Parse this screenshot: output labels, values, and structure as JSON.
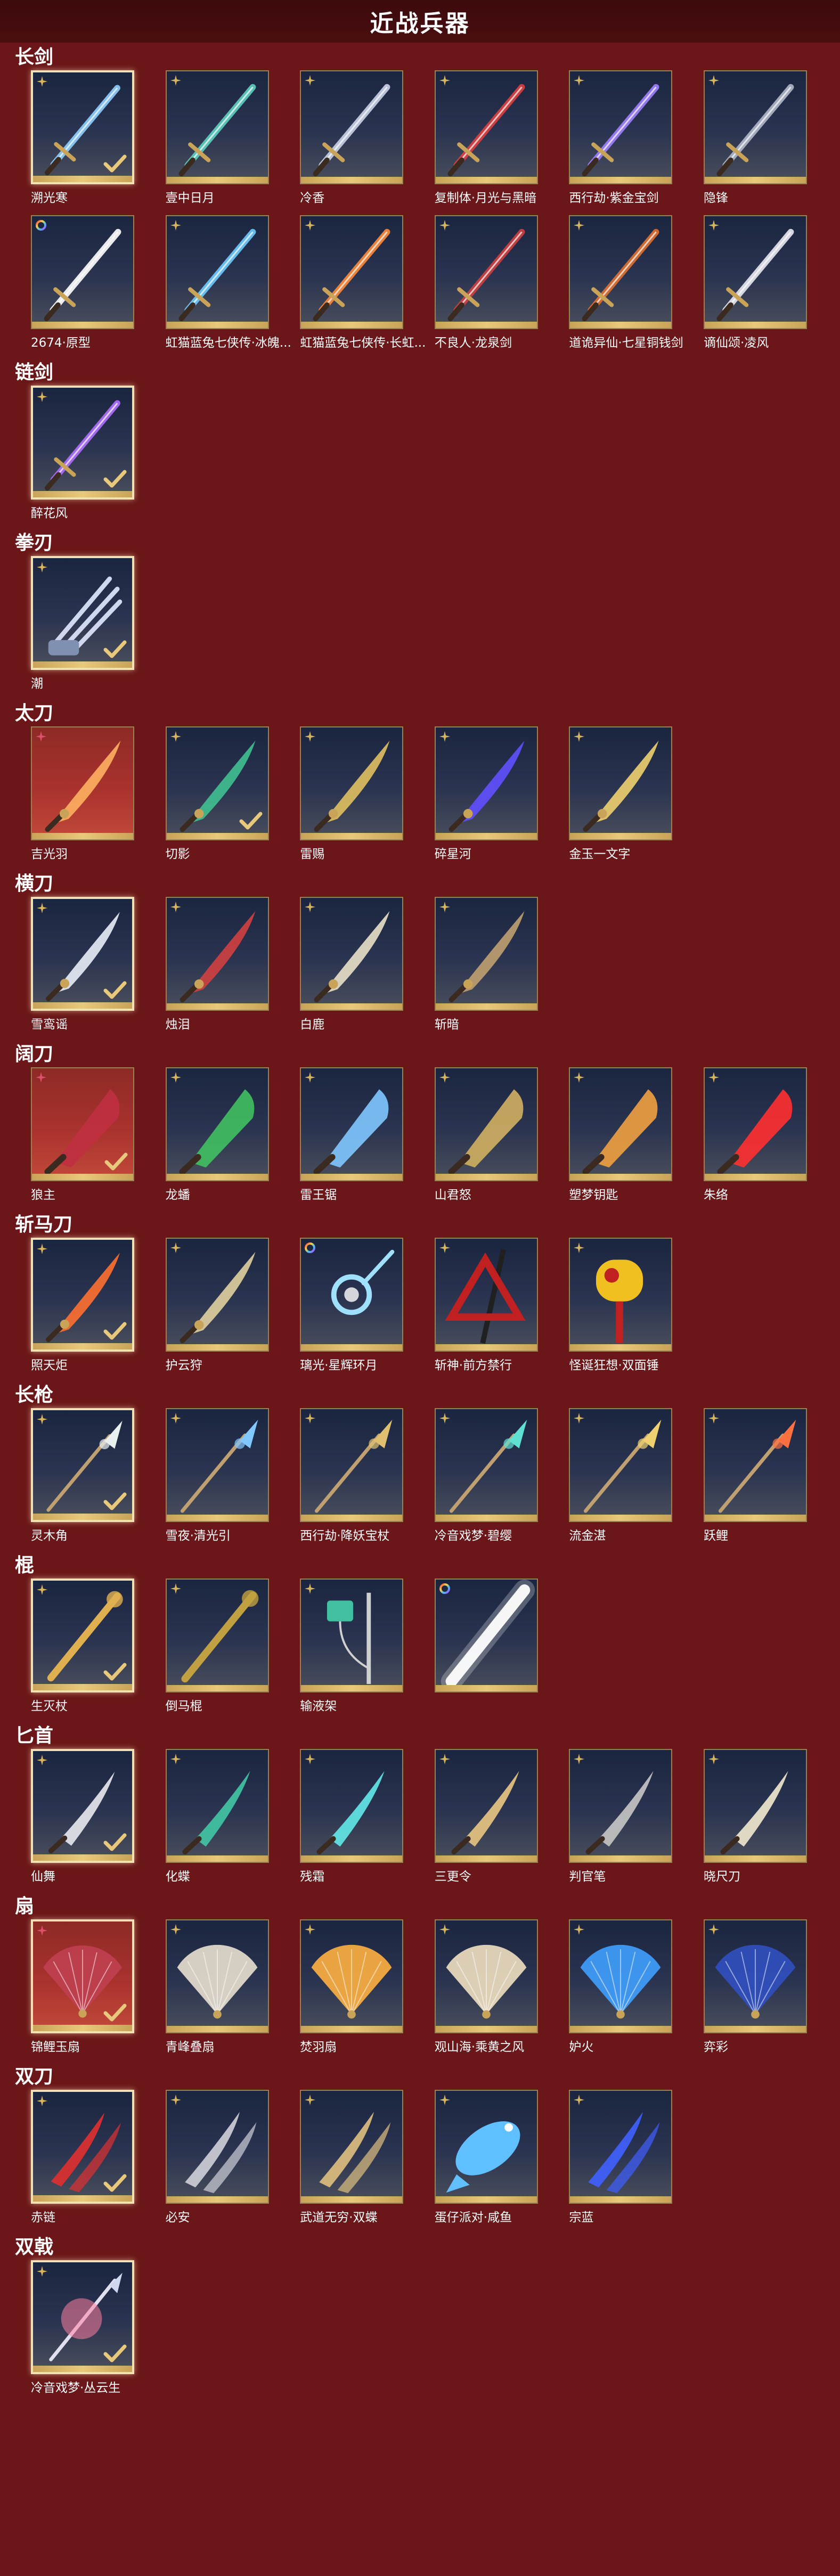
{
  "header": {
    "title": "近战兵器"
  },
  "colors": {
    "background": "#6b1618",
    "header": "#3c0a0c",
    "tile_frame": "#9a8050",
    "tile_frame_selected": "#f1e1b4",
    "tile_bar": "#e8c87a",
    "rarity_gold": "#d9b45a",
    "rarity_red": "#e0506a"
  },
  "sections": [
    {
      "title": "长剑",
      "items": [
        {
          "name": "溯光寒",
          "rarity": "gold",
          "selected": true,
          "checked": true,
          "art": "sword",
          "hue": "#8fd0ff"
        },
        {
          "name": "壹中日月",
          "rarity": "gold",
          "selected": false,
          "checked": false,
          "art": "sword",
          "hue": "#5fd0c0"
        },
        {
          "name": "冷香",
          "rarity": "gold",
          "selected": false,
          "checked": false,
          "art": "sword",
          "hue": "#c9d2e6"
        },
        {
          "name": "复制体·月光与黑暗",
          "rarity": "gold",
          "selected": false,
          "checked": false,
          "art": "sword",
          "hue": "#e04040"
        },
        {
          "name": "西行劫·紫金宝剑",
          "rarity": "gold",
          "selected": false,
          "checked": false,
          "art": "sword",
          "hue": "#a080ff"
        },
        {
          "name": "隐锋",
          "rarity": "gold",
          "selected": false,
          "checked": false,
          "art": "sword",
          "hue": "#b0b8c8"
        },
        {
          "name": "2674·原型",
          "rarity": "rainbow",
          "selected": false,
          "checked": false,
          "art": "sword",
          "hue": "#ffffff"
        },
        {
          "name": "虹猫蓝兔七侠传·冰魄...",
          "rarity": "gold",
          "selected": false,
          "checked": false,
          "art": "sword",
          "hue": "#6ecbff"
        },
        {
          "name": "虹猫蓝兔七侠传·长虹...",
          "rarity": "gold",
          "selected": false,
          "checked": false,
          "art": "sword",
          "hue": "#ff8a3a"
        },
        {
          "name": "不良人·龙泉剑",
          "rarity": "gold",
          "selected": false,
          "checked": false,
          "art": "sword",
          "hue": "#d04040"
        },
        {
          "name": "道诡异仙·七星铜钱剑",
          "rarity": "gold",
          "selected": false,
          "checked": false,
          "art": "sword",
          "hue": "#e07030"
        },
        {
          "name": "谪仙颂·凌风",
          "rarity": "gold",
          "selected": false,
          "checked": false,
          "art": "sword",
          "hue": "#e8e8f0"
        }
      ]
    },
    {
      "title": "链剑",
      "items": [
        {
          "name": "醉花风",
          "rarity": "gold",
          "selected": true,
          "checked": true,
          "art": "sword",
          "hue": "#b070ff"
        }
      ]
    },
    {
      "title": "拳刃",
      "items": [
        {
          "name": "潮",
          "rarity": "gold",
          "selected": true,
          "checked": true,
          "art": "claw",
          "hue": "#d0d8f0"
        }
      ]
    },
    {
      "title": "太刀",
      "items": [
        {
          "name": "吉光羽",
          "rarity": "red",
          "selected": false,
          "checked": false,
          "art": "blade",
          "hue": "#ffb060"
        },
        {
          "name": "切影",
          "rarity": "gold",
          "selected": false,
          "checked": true,
          "art": "blade",
          "hue": "#40c090"
        },
        {
          "name": "雷赐",
          "rarity": "gold",
          "selected": false,
          "checked": false,
          "art": "blade",
          "hue": "#e0c060"
        },
        {
          "name": "碎星河",
          "rarity": "gold",
          "selected": false,
          "checked": false,
          "art": "blade",
          "hue": "#6050ff"
        },
        {
          "name": "金玉一文字",
          "rarity": "gold",
          "selected": false,
          "checked": false,
          "art": "blade",
          "hue": "#f0d070"
        }
      ]
    },
    {
      "title": "横刀",
      "items": [
        {
          "name": "雪鸾谣",
          "rarity": "gold",
          "selected": true,
          "checked": true,
          "art": "blade",
          "hue": "#e8eef8"
        },
        {
          "name": "烛泪",
          "rarity": "gold",
          "selected": false,
          "checked": false,
          "art": "blade",
          "hue": "#d04040"
        },
        {
          "name": "白鹿",
          "rarity": "gold",
          "selected": false,
          "checked": false,
          "art": "blade",
          "hue": "#e8e0c8"
        },
        {
          "name": "斩暗",
          "rarity": "gold",
          "selected": false,
          "checked": false,
          "art": "blade",
          "hue": "#c0a070"
        }
      ]
    },
    {
      "title": "阔刀",
      "items": [
        {
          "name": "狼主",
          "rarity": "red",
          "selected": false,
          "checked": true,
          "art": "broad",
          "hue": "#c03040"
        },
        {
          "name": "龙蟠",
          "rarity": "gold",
          "selected": false,
          "checked": false,
          "art": "broad",
          "hue": "#40c060"
        },
        {
          "name": "雷王锯",
          "rarity": "gold",
          "selected": false,
          "checked": false,
          "art": "broad",
          "hue": "#80c8ff"
        },
        {
          "name": "山君怒",
          "rarity": "gold",
          "selected": false,
          "checked": false,
          "art": "broad",
          "hue": "#d0b060"
        },
        {
          "name": "塑梦钥匙",
          "rarity": "gold",
          "selected": false,
          "checked": false,
          "art": "broad",
          "hue": "#f0a040"
        },
        {
          "name": "朱络",
          "rarity": "gold",
          "selected": false,
          "checked": false,
          "art": "broad",
          "hue": "#ff3030"
        }
      ]
    },
    {
      "title": "斩马刀",
      "items": [
        {
          "name": "照天炬",
          "rarity": "gold",
          "selected": true,
          "checked": true,
          "art": "blade",
          "hue": "#ff7030"
        },
        {
          "name": "护云狩",
          "rarity": "gold",
          "selected": false,
          "checked": false,
          "art": "blade",
          "hue": "#e0d0a0"
        },
        {
          "name": "璃光·星辉环月",
          "rarity": "rainbow",
          "selected": false,
          "checked": false,
          "art": "ring",
          "hue": "#a0e0ff"
        },
        {
          "name": "斩神·前方禁行",
          "rarity": "gold",
          "selected": false,
          "checked": false,
          "art": "sign",
          "hue": "#c02020"
        },
        {
          "name": "怪诞狂想·双面锤",
          "rarity": "gold",
          "selected": false,
          "checked": false,
          "art": "hammer",
          "hue": "#f0c020"
        }
      ]
    },
    {
      "title": "长枪",
      "items": [
        {
          "name": "灵木角",
          "rarity": "gold",
          "selected": true,
          "checked": true,
          "art": "spear",
          "hue": "#e8f0f0"
        },
        {
          "name": "雪夜·清光引",
          "rarity": "gold",
          "selected": false,
          "checked": false,
          "art": "spear",
          "hue": "#80c8ff"
        },
        {
          "name": "西行劫·降妖宝杖",
          "rarity": "gold",
          "selected": false,
          "checked": false,
          "art": "spear",
          "hue": "#e0c070"
        },
        {
          "name": "冷音戏梦·碧缨",
          "rarity": "gold",
          "selected": false,
          "checked": false,
          "art": "spear",
          "hue": "#60e0d0"
        },
        {
          "name": "流金湛",
          "rarity": "gold",
          "selected": false,
          "checked": false,
          "art": "spear",
          "hue": "#f0d070"
        },
        {
          "name": "跃鲤",
          "rarity": "gold",
          "selected": false,
          "checked": false,
          "art": "spear",
          "hue": "#ff7040"
        }
      ]
    },
    {
      "title": "棍",
      "items": [
        {
          "name": "生灭杖",
          "rarity": "gold",
          "selected": true,
          "checked": true,
          "art": "staff",
          "hue": "#e0b050"
        },
        {
          "name": "倒马棍",
          "rarity": "gold",
          "selected": false,
          "checked": false,
          "art": "staff",
          "hue": "#c0a040"
        },
        {
          "name": "输液架",
          "rarity": "gold",
          "selected": false,
          "checked": false,
          "art": "drip",
          "hue": "#40c0a0"
        },
        {
          "name": "",
          "rarity": "rainbow",
          "selected": false,
          "checked": false,
          "art": "light",
          "hue": "#ffffff"
        }
      ]
    },
    {
      "title": "匕首",
      "items": [
        {
          "name": "仙舞",
          "rarity": "gold",
          "selected": true,
          "checked": true,
          "art": "dagger",
          "hue": "#e0e0e8"
        },
        {
          "name": "化蝶",
          "rarity": "gold",
          "selected": false,
          "checked": false,
          "art": "dagger",
          "hue": "#40c0a0"
        },
        {
          "name": "残霜",
          "rarity": "gold",
          "selected": false,
          "checked": false,
          "art": "dagger",
          "hue": "#60e0e0"
        },
        {
          "name": "三更令",
          "rarity": "gold",
          "selected": false,
          "checked": false,
          "art": "dagger",
          "hue": "#e0c080"
        },
        {
          "name": "判官笔",
          "rarity": "gold",
          "selected": false,
          "checked": false,
          "art": "dagger",
          "hue": "#c0c0c0"
        },
        {
          "name": "晓尺刀",
          "rarity": "gold",
          "selected": false,
          "checked": false,
          "art": "dagger",
          "hue": "#e8e0c8"
        }
      ]
    },
    {
      "title": "扇",
      "items": [
        {
          "name": "锦鲤玉扇",
          "rarity": "red",
          "selected": true,
          "checked": true,
          "art": "fan",
          "hue": "#c04050"
        },
        {
          "name": "青峰叠扇",
          "rarity": "gold",
          "selected": false,
          "checked": false,
          "art": "fan",
          "hue": "#e8e0d0"
        },
        {
          "name": "焚羽扇",
          "rarity": "gold",
          "selected": false,
          "checked": false,
          "art": "fan",
          "hue": "#ffb040"
        },
        {
          "name": "观山海·乘黄之风",
          "rarity": "gold",
          "selected": false,
          "checked": false,
          "art": "fan",
          "hue": "#f0e0c0"
        },
        {
          "name": "妒火",
          "rarity": "gold",
          "selected": false,
          "checked": false,
          "art": "fan",
          "hue": "#40a0ff"
        },
        {
          "name": "弈彩",
          "rarity": "gold",
          "selected": false,
          "checked": false,
          "art": "fan",
          "hue": "#3050c0"
        }
      ]
    },
    {
      "title": "双刀",
      "items": [
        {
          "name": "赤链",
          "rarity": "gold",
          "selected": true,
          "checked": true,
          "art": "twin",
          "hue": "#e03030"
        },
        {
          "name": "必安",
          "rarity": "gold",
          "selected": false,
          "checked": false,
          "art": "twin",
          "hue": "#d0d0d8"
        },
        {
          "name": "武道无穷·双蝶",
          "rarity": "gold",
          "selected": false,
          "checked": false,
          "art": "twin",
          "hue": "#e0c080"
        },
        {
          "name": "蛋仔派对·咸鱼",
          "rarity": "gold",
          "selected": false,
          "checked": false,
          "art": "fish",
          "hue": "#60c0ff"
        },
        {
          "name": "宗蓝",
          "rarity": "gold",
          "selected": false,
          "checked": false,
          "art": "twin",
          "hue": "#4060ff"
        }
      ]
    },
    {
      "title": "双戟",
      "items": [
        {
          "name": "冷音戏梦·丛云生",
          "rarity": "gold",
          "selected": true,
          "checked": true,
          "art": "halberd",
          "hue": "#ff80a0"
        }
      ]
    }
  ]
}
